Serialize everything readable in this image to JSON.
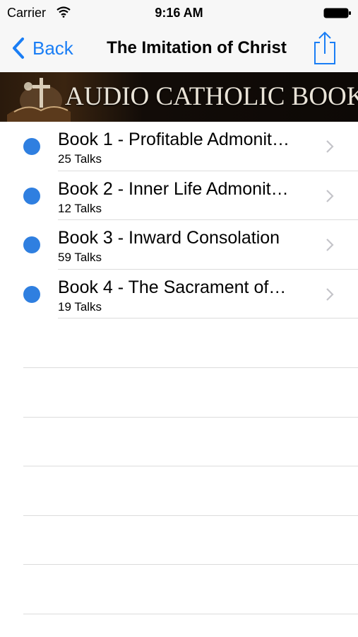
{
  "status_bar": {
    "carrier": "Carrier",
    "time": "9:16 AM",
    "wifi_icon": "wifi-icon",
    "battery_icon": "battery-icon"
  },
  "nav": {
    "back_label": "Back",
    "title": "The Imitation of Christ",
    "share_icon": "share-icon"
  },
  "banner": {
    "text": "AUDIO CATHOLIC BOOKS"
  },
  "books": [
    {
      "title": "Book 1 - Profitable Admonit…",
      "subtitle": "25 Talks"
    },
    {
      "title": "Book 2 - Inner Life Admonit…",
      "subtitle": "12 Talks"
    },
    {
      "title": "Book 3 - Inward Consolation",
      "subtitle": "59 Talks"
    },
    {
      "title": "Book 4 - The Sacrament of…",
      "subtitle": "19 Talks"
    }
  ],
  "colors": {
    "accent": "#1a7ef5",
    "unread_dot": "#2f7fe0",
    "separator": "#dcdcdc"
  }
}
